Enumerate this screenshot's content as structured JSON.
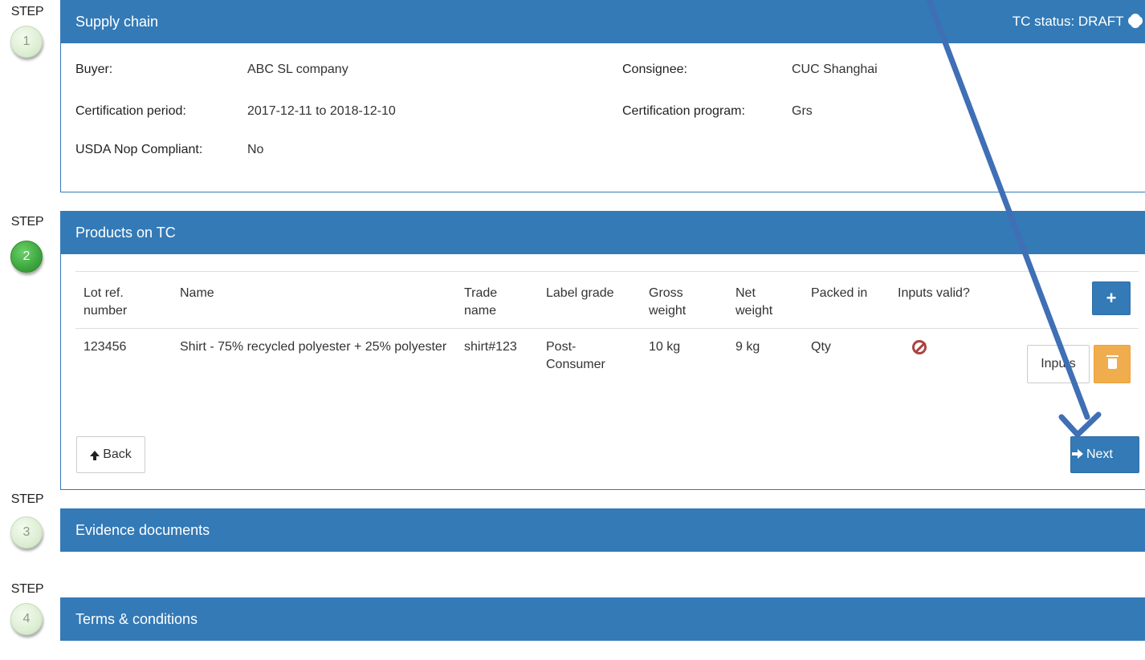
{
  "steps": {
    "step_word": "STEP",
    "numbers": [
      "1",
      "2",
      "3",
      "4"
    ]
  },
  "supply_chain": {
    "title": "Supply chain",
    "status": "TC status: DRAFT",
    "buyer_label": "Buyer:",
    "buyer_value": "ABC SL company",
    "period_label": "Certification period:",
    "period_value": "2017-12-11 to 2018-12-10",
    "usda_label": "USDA Nop Compliant:",
    "usda_value": "No",
    "consignee_label": "Consignee:",
    "consignee_value": "CUC Shanghai",
    "program_label": "Certification program:",
    "program_value": "Grs"
  },
  "products": {
    "title": "Products on TC",
    "columns": {
      "lot": "Lot ref. number",
      "name": "Name",
      "trade": "Trade name",
      "grade": "Label grade",
      "gross": "Gross weight",
      "net": "Net weight",
      "packed": "Packed in",
      "valid": "Inputs valid?"
    },
    "add_button": "+",
    "rows": [
      {
        "lot": "123456",
        "name": "Shirt - 75% recycled polyester + 25% polyester",
        "trade": "shirt#123",
        "grade": "Post-Consumer",
        "gross": "10 kg",
        "net": "9 kg",
        "packed": "Qty",
        "inputs_button": "Inputs"
      }
    ],
    "back_button": "Back",
    "next_button": "Next"
  },
  "evidence": {
    "title": "Evidence documents"
  },
  "terms": {
    "title": "Terms & conditions"
  },
  "colors": {
    "panel_blue": "#337ab7",
    "warning": "#f0ad4e",
    "danger": "#a94442",
    "annotation_arrow": "#3f6fb5"
  },
  "icons": [
    "gear-icon",
    "plus-icon",
    "ban-icon",
    "trash-icon",
    "arrow-up-icon",
    "arrow-right-icon"
  ]
}
